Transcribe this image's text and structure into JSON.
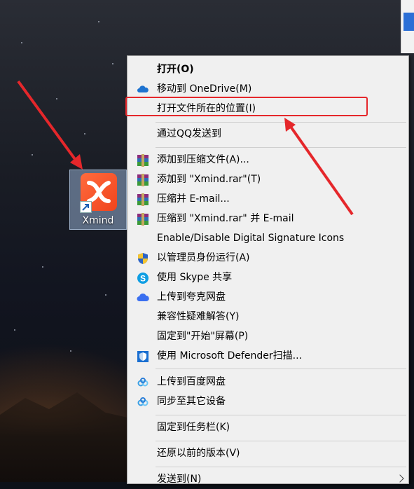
{
  "desktop": {
    "icon_label": "Xmind"
  },
  "context_menu": {
    "items": [
      {
        "label": "打开(O)",
        "icon": "none",
        "bold": true
      },
      {
        "label": "移动到 OneDrive(M)",
        "icon": "onedrive-cloud-icon"
      },
      {
        "label": "打开文件所在的位置(I)",
        "icon": "none",
        "highlighted": true
      },
      {
        "label": "通过QQ发送到",
        "icon": "none"
      },
      {
        "label": "添加到压缩文件(A)...",
        "icon": "winrar-icon"
      },
      {
        "label": "添加到 \"Xmind.rar\"(T)",
        "icon": "winrar-icon"
      },
      {
        "label": "压缩并 E-mail...",
        "icon": "winrar-icon"
      },
      {
        "label": "压缩到 \"Xmind.rar\" 并 E-mail",
        "icon": "winrar-icon"
      },
      {
        "label": "Enable/Disable Digital Signature Icons",
        "icon": "none"
      },
      {
        "label": "以管理员身份运行(A)",
        "icon": "uac-shield-icon"
      },
      {
        "label": "使用 Skype 共享",
        "icon": "skype-icon"
      },
      {
        "label": "上传到夸克网盘",
        "icon": "quark-cloud-icon"
      },
      {
        "label": "兼容性疑难解答(Y)",
        "icon": "none"
      },
      {
        "label": "固定到\"开始\"屏幕(P)",
        "icon": "none"
      },
      {
        "label": "使用 Microsoft Defender扫描...",
        "icon": "defender-icon"
      },
      {
        "label": "上传到百度网盘",
        "icon": "baidu-netdisk-icon"
      },
      {
        "label": "同步至其它设备",
        "icon": "baidu-netdisk-icon"
      },
      {
        "label": "固定到任务栏(K)",
        "icon": "none"
      },
      {
        "label": "还原以前的版本(V)",
        "icon": "none"
      },
      {
        "label": "发送到(N)",
        "icon": "none",
        "submenu": true
      }
    ]
  },
  "colors": {
    "annotation_red": "#e5272b",
    "menu_bg": "#f0f0f0",
    "xmind_orange": "#f0441d"
  }
}
